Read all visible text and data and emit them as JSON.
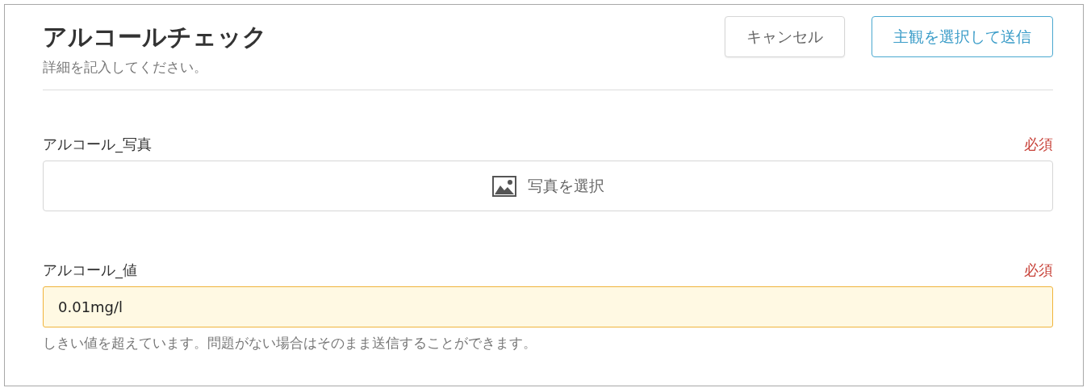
{
  "header": {
    "title": "アルコールチェック",
    "subtitle": "詳細を記入してください。"
  },
  "buttons": [
    {
      "kind": "secondary",
      "label": "キャンセル"
    },
    {
      "kind": "primary",
      "label": "主観を選択して送信"
    }
  ],
  "fields": [
    {
      "kind": "photo",
      "label": "アルコール_写真",
      "required": "必須",
      "button": "写真を選択"
    },
    {
      "kind": "text",
      "label": "アルコール_値",
      "required": "必須",
      "value": "0.01mg/l",
      "warning": true,
      "help": "しきい値を超えています。問題がない場合はそのまま送信することができます。"
    }
  ]
}
